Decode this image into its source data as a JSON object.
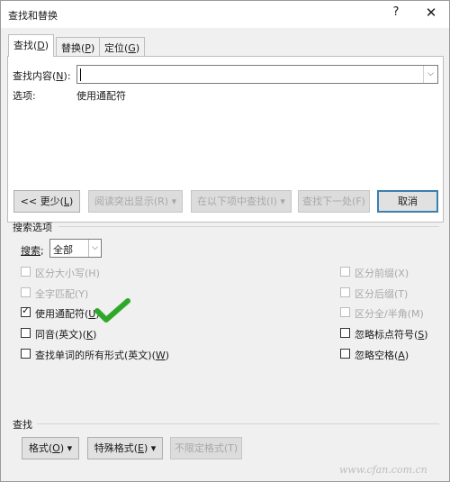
{
  "window": {
    "title": "查找和替换",
    "help": "?",
    "close": "✕"
  },
  "tabs": [
    {
      "label": "查找(",
      "key": "D",
      "suffix": ")"
    },
    {
      "label": "替换(",
      "key": "P",
      "suffix": ")"
    },
    {
      "label": "定位(",
      "key": "G",
      "suffix": ")"
    }
  ],
  "find": {
    "label_pre": "查找内容(",
    "label_key": "N",
    "label_post": "):",
    "value": "",
    "options_label": "选项:",
    "options_value": "使用通配符"
  },
  "buttons": {
    "less": {
      "pre": "<< 更少(",
      "key": "L",
      "post": ")"
    },
    "reading_highlight": "阅读突出显示(R) ▾",
    "find_in": "在以下项中查找(I) ▾",
    "find_next": "查找下一处(F)",
    "cancel": "取消"
  },
  "search_options": {
    "title": "搜索选项",
    "search_label_pre": "搜索",
    "search_label_post": ";",
    "search_value": "全部",
    "left": [
      {
        "label": "区分大小写(H)",
        "checked": false,
        "disabled": true
      },
      {
        "label": "全字匹配(Y)",
        "checked": false,
        "disabled": true
      },
      {
        "label_pre": "使用通配符(",
        "key": "U",
        "label_post": ")",
        "checked": true,
        "disabled": false
      },
      {
        "label_pre": "同音(英文)(",
        "key": "K",
        "label_post": ")",
        "checked": false,
        "disabled": false
      },
      {
        "label_pre": "查找单词的所有形式(英文)(",
        "key": "W",
        "label_post": ")",
        "checked": false,
        "disabled": false
      }
    ],
    "right": [
      {
        "label": "区分前缀(X)",
        "checked": false,
        "disabled": true
      },
      {
        "label": "区分后缀(T)",
        "checked": false,
        "disabled": true
      },
      {
        "label": "区分全/半角(M)",
        "checked": false,
        "disabled": true
      },
      {
        "label_pre": "忽略标点符号(",
        "key": "S",
        "label_post": ")",
        "checked": false,
        "disabled": false
      },
      {
        "label_pre": "忽略空格(",
        "key": "A",
        "label_post": ")",
        "checked": false,
        "disabled": false
      }
    ]
  },
  "find_section": {
    "title": "查找",
    "format": {
      "pre": "格式(",
      "key": "O",
      "post": ") ▾"
    },
    "special": {
      "pre": "特殊格式(",
      "key": "E",
      "post": ") ▾"
    },
    "no_format": "不限定格式(T)"
  },
  "annotation": {
    "icon": "green-checkmark",
    "color": "#2fa82a"
  },
  "watermark": "www.cfan.com.cn"
}
